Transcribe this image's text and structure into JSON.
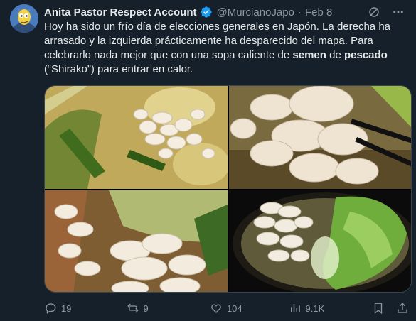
{
  "tweet": {
    "display_name": "Anita Pastor Respect Account",
    "handle": "@MurcianoJapo",
    "separator": "·",
    "date": "Feb 8",
    "text": {
      "part1": "Hoy ha sido un frío día de elecciones generales en Japón. La derecha ha arrasado y la izquierda prácticamente ha desparecido del mapa. Para celebrarlo nada mejor que con una sopa caliente de ",
      "bold1": "semen",
      "part2": " de ",
      "bold2": "pescado",
      "part3": " (“Shirako”) para entrar en calor."
    },
    "media": [
      {
        "icon": "photo-shirako-soup-1"
      },
      {
        "icon": "photo-shirako-chopsticks"
      },
      {
        "icon": "photo-shirako-soup-3"
      },
      {
        "icon": "photo-shirako-bowl-dark"
      }
    ]
  },
  "actions": {
    "replies": "19",
    "reposts": "9",
    "likes": "104",
    "views": "9.1K"
  },
  "colors": {
    "background": "#15202b",
    "text": "#e7e9ea",
    "secondary": "#8b98a5",
    "verified": "#1d9bf0"
  }
}
